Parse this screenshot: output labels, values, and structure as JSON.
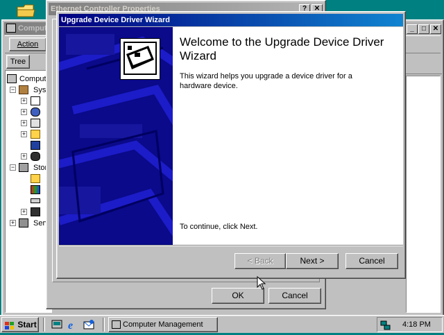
{
  "desktop": {
    "background": "#008080"
  },
  "mgmt": {
    "title": "Computer Management",
    "title_visible": "Compute",
    "menu_action": "Action",
    "tab_tree": "Tree",
    "tree": {
      "root": "Computer Management (Local)",
      "root_visible": "Comput",
      "system_tools": "Syst",
      "storage": "Stor",
      "services": "Serv"
    }
  },
  "props": {
    "title": "Ethernet Controller Properties",
    "help": "?",
    "close": "✕",
    "ok_label": "OK",
    "cancel_label": "Cancel"
  },
  "wizard": {
    "title": "Upgrade Device Driver Wizard",
    "heading": "Welcome to the Upgrade Device Driver Wizard",
    "description": "This wizard helps you upgrade a device driver for a hardware device.",
    "continue_text": "To continue, click Next.",
    "back_label": "< Back",
    "next_label": "Next >",
    "cancel_label": "Cancel"
  },
  "taskbar": {
    "start_label": "Start",
    "task_label": "Computer Management",
    "clock": "4:18 PM"
  },
  "colors": {
    "title_active": "#000080",
    "wizard_panel": "#0a0a8a",
    "face": "#c0c0c0"
  }
}
